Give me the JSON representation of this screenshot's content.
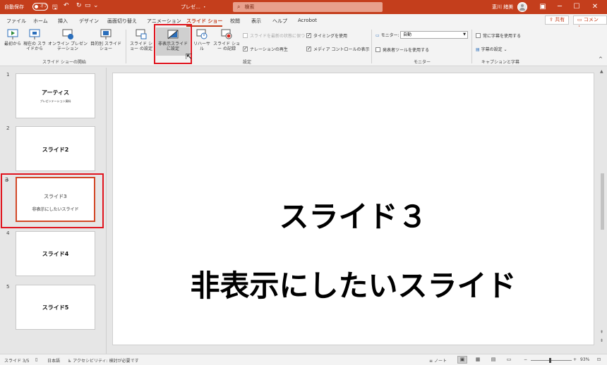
{
  "titlebar": {
    "autosave_label": "自動保存",
    "autosave_state": "オフ",
    "filename": "プレゼ… ・",
    "search_placeholder": "検索",
    "username": "恵川 緒美",
    "accent": "#c43e1c"
  },
  "tabs": [
    {
      "label": "ファイル"
    },
    {
      "label": "ホーム"
    },
    {
      "label": "挿入"
    },
    {
      "label": "デザイン"
    },
    {
      "label": "画面切り替え"
    },
    {
      "label": "アニメーション"
    },
    {
      "label": "スライド ショー"
    },
    {
      "label": "校閲"
    },
    {
      "label": "表示"
    },
    {
      "label": "ヘルプ"
    },
    {
      "label": "Acrobot"
    }
  ],
  "share_label": "共有",
  "comment_label": "コメント",
  "ribbon": {
    "start_group": {
      "label": "スライド ショーの開始",
      "from_beginning": "最初から",
      "from_current": "現在の スライドから",
      "online": "オンライン プレゼンテーション",
      "custom": "目的別 スライド ショー"
    },
    "setup_group": {
      "label": "設定",
      "setup_show": "スライド ショー の設定",
      "hide_slide": "非表示スライド に設定",
      "rehearse": "リハーサル",
      "record": "スライド ショー の記録",
      "keep_updated": "スライドを最新の状態に保つ",
      "play_narration": "ナレーションの再生",
      "use_timings": "タイミングを使用",
      "media_controls": "メディア コントロールの表示"
    },
    "monitor_group": {
      "label": "モニター",
      "monitor_label": "モニター:",
      "monitor_value": "自動",
      "presenter_view": "発表者ツールを使用する"
    },
    "captions_group": {
      "label": "キャプションと字幕",
      "always_subtitles": "常に字幕を使用する",
      "subtitle_settings": "字幕の設定"
    }
  },
  "slides": [
    {
      "num": "1",
      "title": "アーティス",
      "subtitle": "プレゼンテーション資料"
    },
    {
      "num": "2",
      "title": "スライド2",
      "subtitle": ""
    },
    {
      "num": "3",
      "title": "スライド3",
      "subtitle": "非表示にしたいスライド"
    },
    {
      "num": "4",
      "title": "スライド4",
      "subtitle": ""
    },
    {
      "num": "5",
      "title": "スライド5",
      "subtitle": ""
    }
  ],
  "main_slide": {
    "title": "スライド３",
    "body": "非表示にしたいスライド"
  },
  "statusbar": {
    "slide_pos": "スライド 3/5",
    "language": "日本語",
    "accessibility": "アクセシビリティ: 検討が必要です",
    "notes": "ノート",
    "zoom": "93%",
    "zoom_fraction": 0.47
  }
}
